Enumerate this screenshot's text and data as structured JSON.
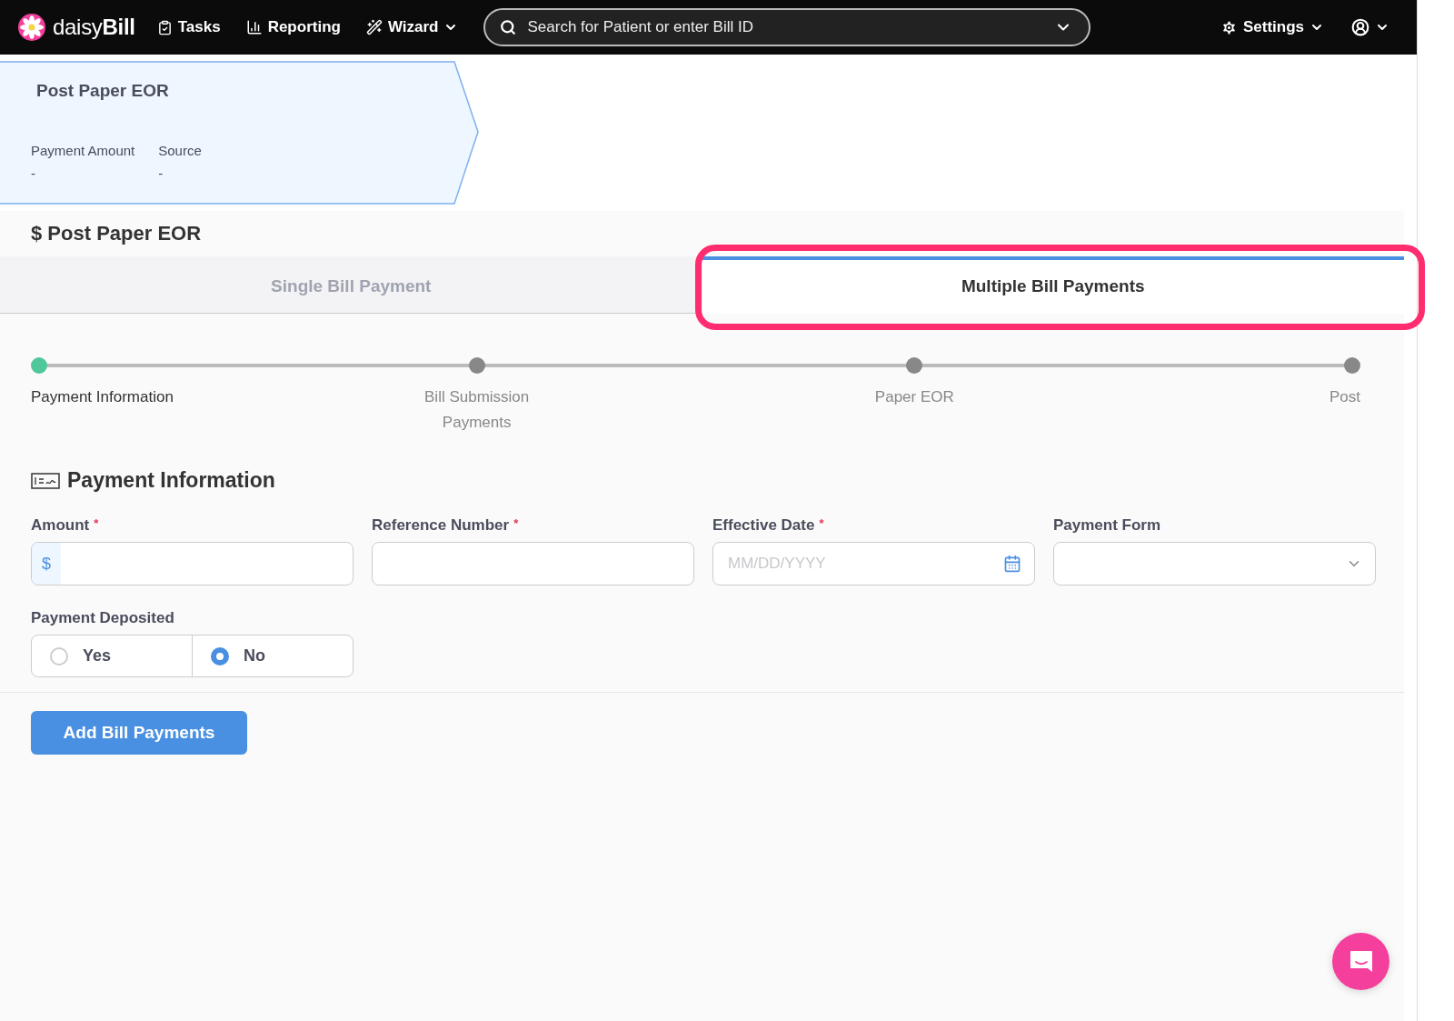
{
  "nav": {
    "logo": "daisy**Bill**",
    "items": [
      {
        "kind": "tasks",
        "label": "Tasks",
        "caret": false
      },
      {
        "kind": "reporting",
        "label": "Reporting",
        "caret": false
      },
      {
        "kind": "wizard",
        "label": "Wizard",
        "caret": true
      }
    ],
    "search": {
      "placeholder": "Search for Patient or enter Bill ID"
    },
    "settings": {
      "label": "Settings"
    }
  },
  "breadcrumb": {
    "title": "Post Paper EOR",
    "fields": [
      {
        "label": "Payment Amount",
        "value": "-"
      },
      {
        "label": "Source",
        "value": "-"
      }
    ]
  },
  "page_title": "$ Post Paper EOR",
  "tabs": [
    {
      "label": "Single Bill Payment",
      "selected": false,
      "highlighted": false
    },
    {
      "label": "Multiple Bill Payments",
      "selected": true,
      "highlighted": true
    }
  ],
  "steps": [
    {
      "label": "Payment Information",
      "current": true
    },
    {
      "label": "Bill Submission Payments",
      "current": false
    },
    {
      "label": "Paper EOR",
      "current": false
    },
    {
      "label": "Post",
      "current": false
    }
  ],
  "section_title": "Payment Information",
  "required_mark": "*",
  "fields": [
    {
      "kind": "currency",
      "label": "Amount",
      "required": true,
      "prefix": "$"
    },
    {
      "kind": "text",
      "label": "Reference Number",
      "required": true
    },
    {
      "kind": "date",
      "label": "Effective Date",
      "required": true,
      "placeholder": "MM/DD/YYYY"
    },
    {
      "kind": "select",
      "label": "Payment Form",
      "required": false
    }
  ],
  "deposited": {
    "label": "Payment Deposited",
    "options": [
      {
        "label": "Yes",
        "selected": false
      },
      {
        "label": "No",
        "selected": true
      }
    ]
  },
  "submit": "Add Bill Payments"
}
